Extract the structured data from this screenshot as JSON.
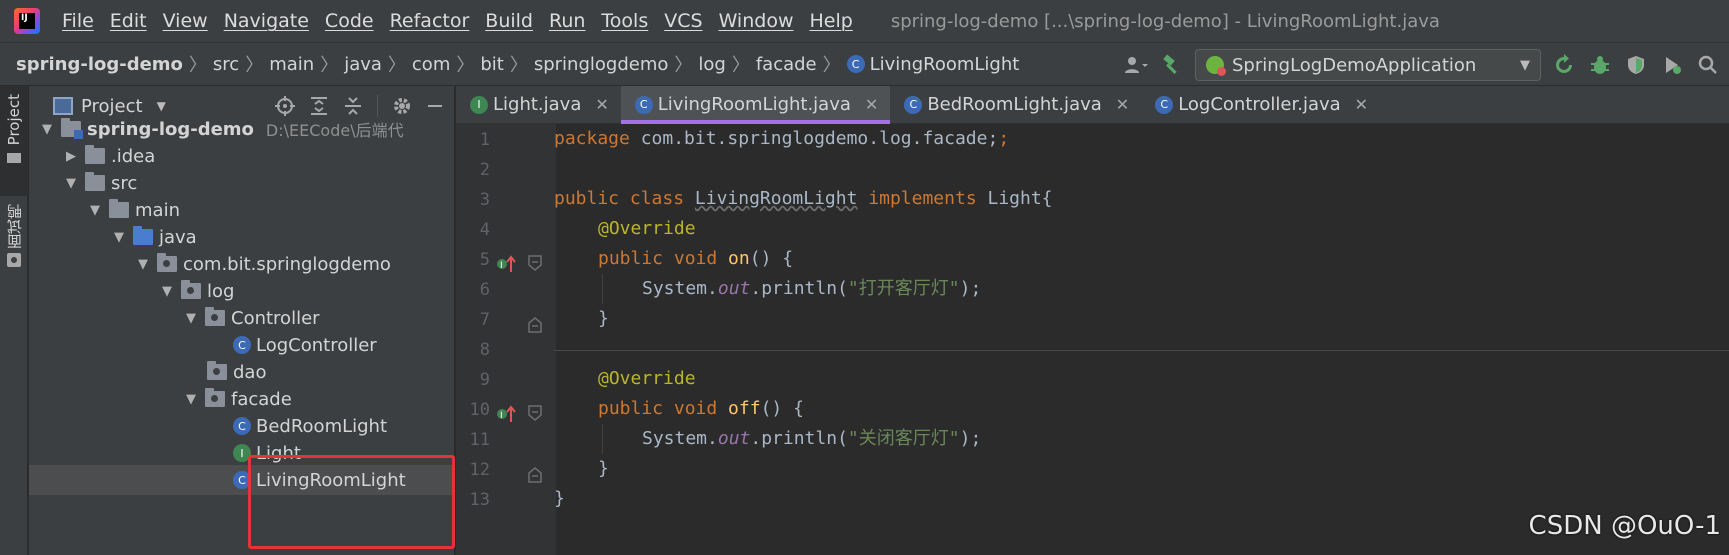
{
  "menu": {
    "items": [
      "File",
      "Edit",
      "View",
      "Navigate",
      "Code",
      "Refactor",
      "Build",
      "Run",
      "Tools",
      "VCS",
      "Window",
      "Help"
    ],
    "window_title": "spring-log-demo [...\\spring-log-demo] - LivingRoomLight.java"
  },
  "breadcrumb": [
    "spring-log-demo",
    "src",
    "main",
    "java",
    "com",
    "bit",
    "springlogdemo",
    "log",
    "facade",
    "LivingRoomLight"
  ],
  "run_config": {
    "label": "SpringLogDemoApplication"
  },
  "sidebar": {
    "project_tab": "Project",
    "second_tab": "面试鸭"
  },
  "project_panel": {
    "title": "Project",
    "tree": [
      {
        "label": "spring-log-demo",
        "path": "D:\\EECode\\后端代",
        "level": 0,
        "expanded": true,
        "kind": "module"
      },
      {
        "label": ".idea",
        "level": 1,
        "expanded": false,
        "kind": "folder"
      },
      {
        "label": "src",
        "level": 1,
        "expanded": true,
        "kind": "folder"
      },
      {
        "label": "main",
        "level": 2,
        "expanded": true,
        "kind": "folder"
      },
      {
        "label": "java",
        "level": 3,
        "expanded": true,
        "kind": "source"
      },
      {
        "label": "com.bit.springlogdemo",
        "level": 4,
        "expanded": true,
        "kind": "package"
      },
      {
        "label": "log",
        "level": 5,
        "expanded": true,
        "kind": "package"
      },
      {
        "label": "Controller",
        "level": 6,
        "expanded": true,
        "kind": "package"
      },
      {
        "label": "LogController",
        "level": 7,
        "kind": "class"
      },
      {
        "label": "dao",
        "level": 6,
        "kind": "package"
      },
      {
        "label": "facade",
        "level": 6,
        "expanded": true,
        "kind": "package"
      },
      {
        "label": "BedRoomLight",
        "level": 7,
        "kind": "class"
      },
      {
        "label": "Light",
        "level": 7,
        "kind": "interface"
      },
      {
        "label": "LivingRoomLight",
        "level": 7,
        "kind": "class",
        "selected": true
      }
    ]
  },
  "editor": {
    "tabs": [
      {
        "label": "Light.java",
        "kind": "interface",
        "active": false
      },
      {
        "label": "LivingRoomLight.java",
        "kind": "class",
        "active": true
      },
      {
        "label": "BedRoomLight.java",
        "kind": "class",
        "active": false
      },
      {
        "label": "LogController.java",
        "kind": "class",
        "active": false
      }
    ],
    "line_numbers": [
      "1",
      "2",
      "3",
      "4",
      "5",
      "6",
      "7",
      "8",
      "9",
      "10",
      "11",
      "12",
      "13"
    ],
    "code": {
      "l1_kw": "package",
      "l1_rest": " com.bit.springlogdemo.log.facade;",
      "l3_kw1": "public class ",
      "l3_name": "LivingRoomLight",
      "l3_kw2": " implements ",
      "l3_rest": "Light{",
      "l4_ann": "@Override",
      "l5_kw": "public void ",
      "l5_fn": "on",
      "l5_rest": "() {",
      "l6_a": "System.",
      "l6_out": "out",
      "l6_b": ".println(",
      "l6_str": "\"打开客厅灯\"",
      "l6_c": ");",
      "l7": "}",
      "l9_ann": "@Override",
      "l10_kw": "public void ",
      "l10_fn": "off",
      "l10_rest": "() {",
      "l11_a": "System.",
      "l11_out": "out",
      "l11_b": ".println(",
      "l11_str": "\"关闭客厅灯\"",
      "l11_c": ");",
      "l12": "}",
      "l13": "}"
    }
  },
  "watermark": "CSDN @OuO-1",
  "colors": {
    "accent_tab": "#a571e6",
    "highlight_box": "#e8323a",
    "class_badge": "#3d6ab6",
    "interface_badge": "#3e8652"
  }
}
